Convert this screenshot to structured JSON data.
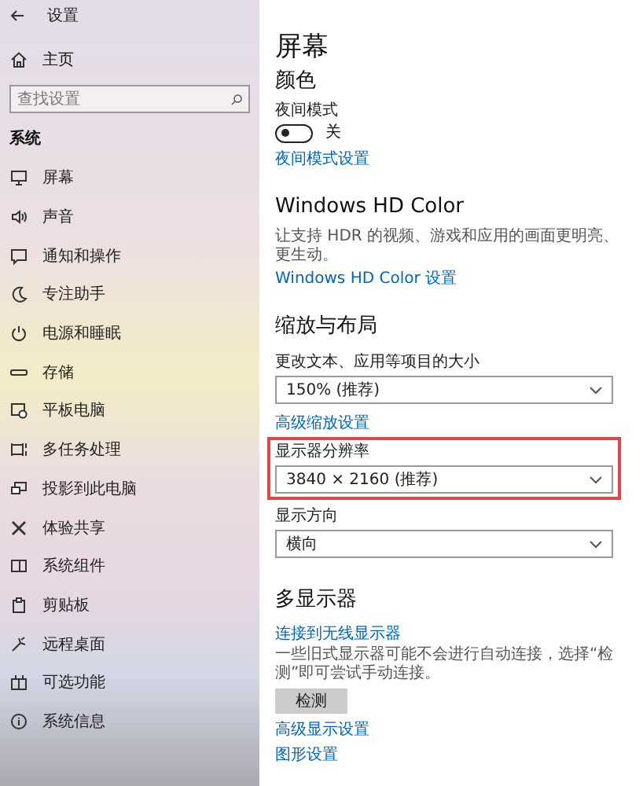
{
  "window": {
    "title": "设置"
  },
  "sidebar": {
    "home": "主页",
    "search": {
      "placeholder": "查找设置"
    },
    "section": "系统",
    "items": [
      {
        "label": "屏幕"
      },
      {
        "label": "声音"
      },
      {
        "label": "通知和操作"
      },
      {
        "label": "专注助手"
      },
      {
        "label": "电源和睡眠"
      },
      {
        "label": "存储"
      },
      {
        "label": "平板电脑"
      },
      {
        "label": "多任务处理"
      },
      {
        "label": "投影到此电脑"
      },
      {
        "label": "体验共享"
      },
      {
        "label": "系统组件"
      },
      {
        "label": "剪贴板"
      },
      {
        "label": "远程桌面"
      },
      {
        "label": "可选功能"
      },
      {
        "label": "系统信息"
      }
    ]
  },
  "main": {
    "title": "屏幕",
    "blocks": [
      {
        "kind": "heading",
        "text": "颜色"
      },
      {
        "kind": "toggle",
        "label": "夜间模式",
        "on": false,
        "state_text": "关"
      },
      {
        "kind": "link",
        "text": "夜间模式设置"
      },
      {
        "kind": "heading",
        "text": "Windows HD Color"
      },
      {
        "kind": "text",
        "text": "让支持 HDR 的视频、游戏和应用的画面更明亮、更生动。"
      },
      {
        "kind": "link",
        "text": "Windows HD Color 设置"
      },
      {
        "kind": "heading",
        "text": "缩放与布局"
      },
      {
        "kind": "dropdown",
        "label": "更改文本、应用等项目的大小",
        "value": "150% (推荐)",
        "highlighted": false
      },
      {
        "kind": "link",
        "text": "高级缩放设置"
      },
      {
        "kind": "dropdown",
        "label": "显示器分辨率",
        "value": "3840 × 2160 (推荐)",
        "highlighted": true
      },
      {
        "kind": "dropdown",
        "label": "显示方向",
        "value": "横向",
        "highlighted": false
      },
      {
        "kind": "heading",
        "text": "多显示器"
      },
      {
        "kind": "link",
        "text": "连接到无线显示器"
      },
      {
        "kind": "text",
        "text": "一些旧式显示器可能不会进行自动连接，选择“检测”即可尝试手动连接。"
      },
      {
        "kind": "button",
        "text": "检测"
      },
      {
        "kind": "link",
        "text": "高级显示设置"
      },
      {
        "kind": "link",
        "text": "图形设置"
      }
    ]
  }
}
